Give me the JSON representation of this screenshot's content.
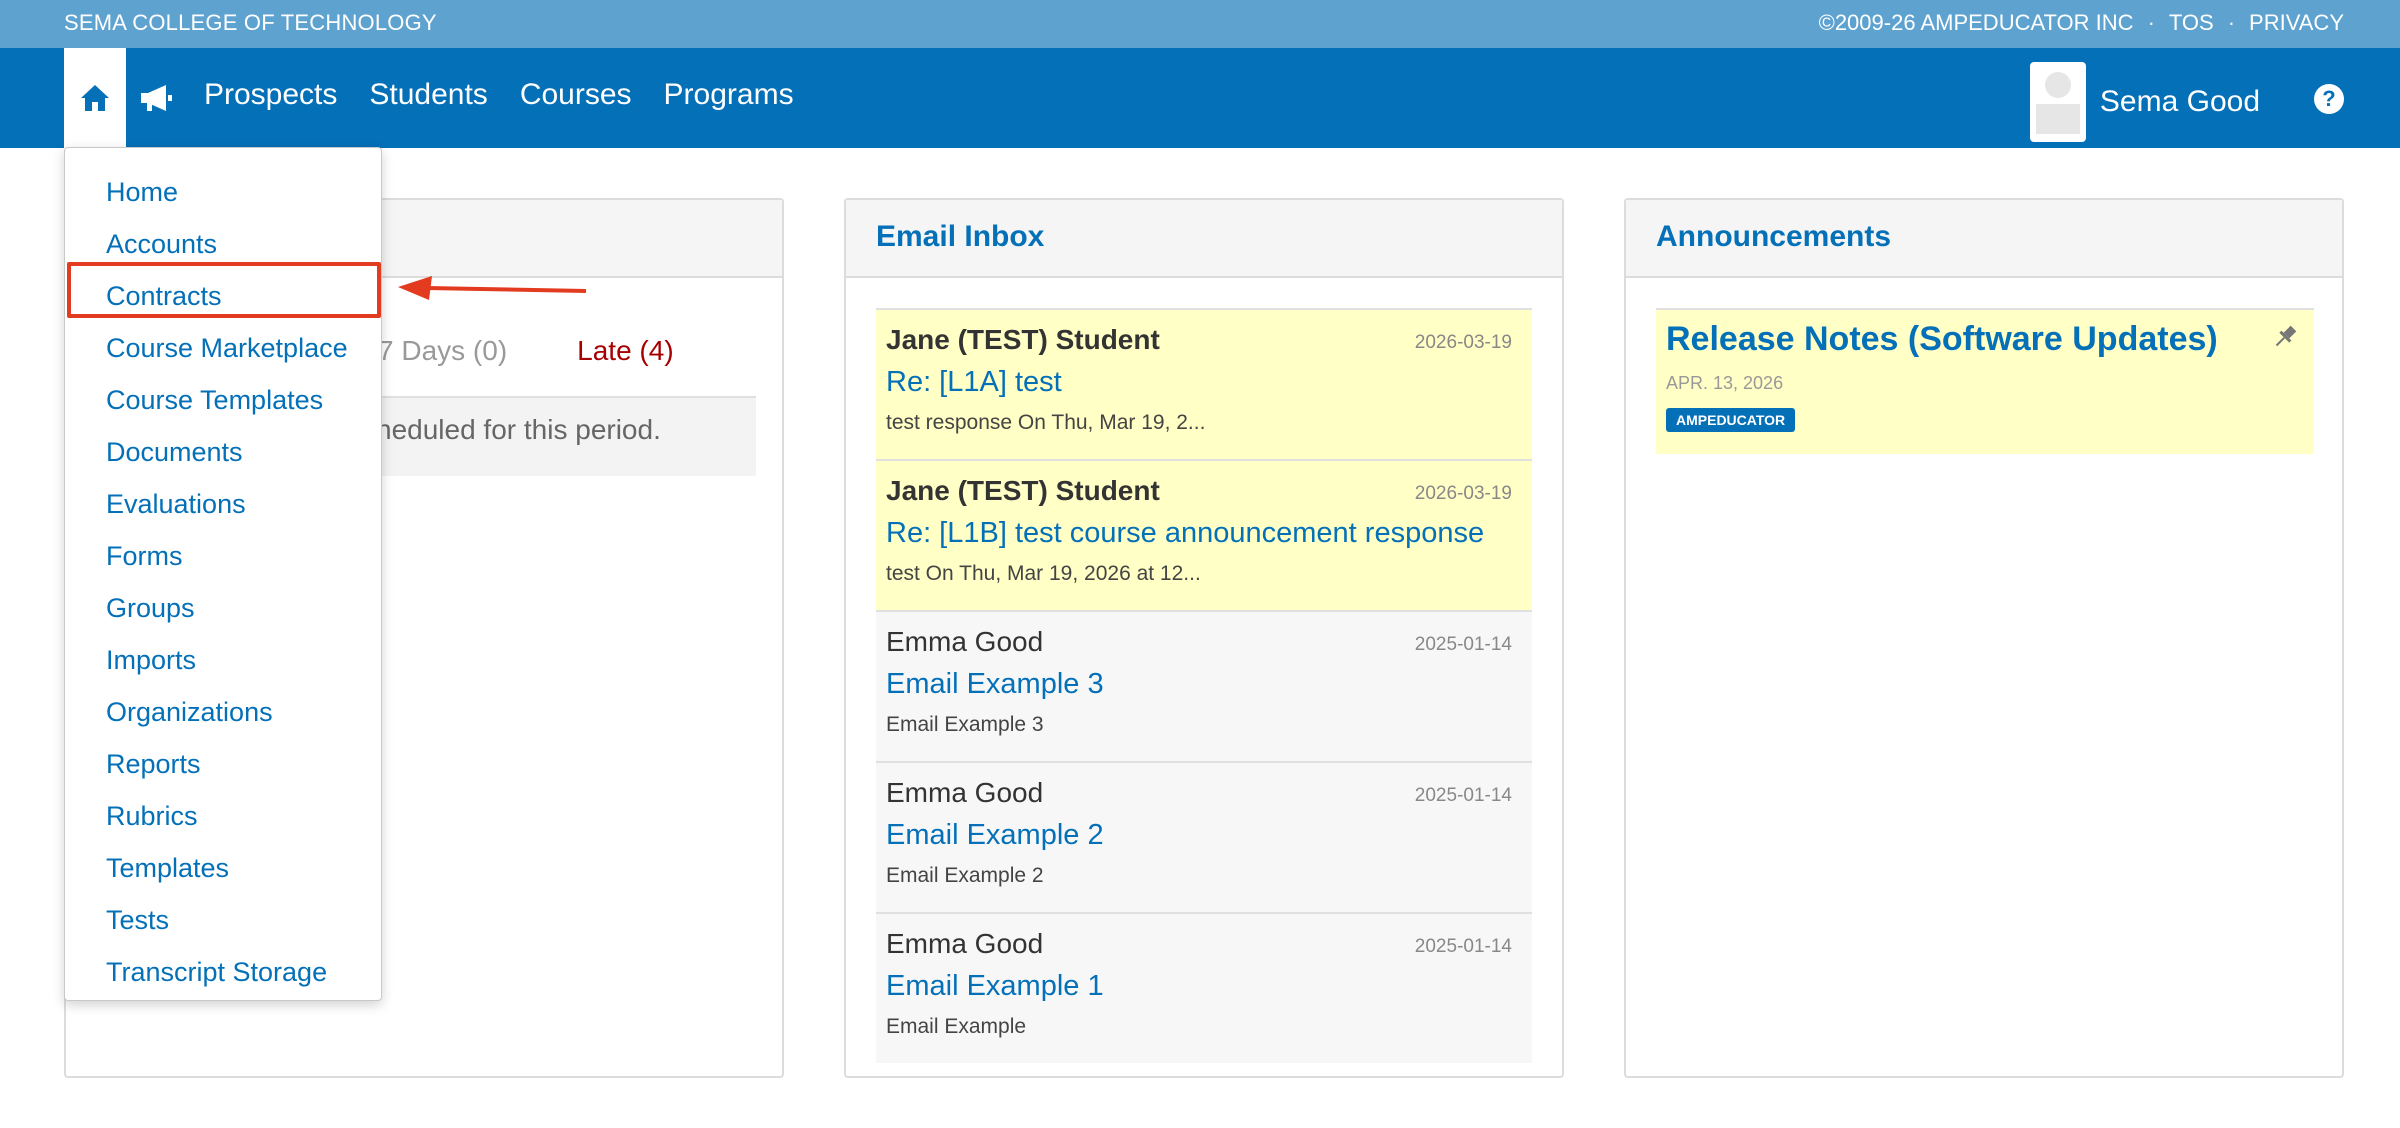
{
  "top_strip": {
    "school": "SEMA COLLEGE OF TECHNOLOGY",
    "copyright": "©2009-26 AMPEDUCATOR INC",
    "tos": "TOS",
    "privacy": "PRIVACY",
    "separator": "·"
  },
  "nav": {
    "links": [
      "Prospects",
      "Students",
      "Courses",
      "Programs"
    ],
    "user_name": "Sema Good",
    "help_glyph": "?",
    "icons": [
      "home-icon",
      "megaphone-icon",
      "avatar",
      "help-icon"
    ],
    "colors": {
      "primary": "#0470b8",
      "strip": "#5ea2d0"
    }
  },
  "dropdown": {
    "items": [
      "Home",
      "Accounts",
      "Contracts",
      "Course Marketplace",
      "Course Templates",
      "Documents",
      "Evaluations",
      "Forms",
      "Groups",
      "Imports",
      "Organizations",
      "Reports",
      "Rubrics",
      "Templates",
      "Tests",
      "Transcript Storage"
    ],
    "highlighted_item": "Contracts",
    "highlight_color": "#e33b1f"
  },
  "tasks_panel": {
    "tab_next7": "7 Days (0)",
    "tab_late": "Late (4)",
    "empty_text": "heduled for this period."
  },
  "email_panel": {
    "title": "Email Inbox",
    "emails": [
      {
        "from": "Jane (TEST) Student",
        "date": "2026-03-19",
        "subject": "Re: [L1A] test",
        "preview": "test response On Thu, Mar 19, 2...",
        "unread": true
      },
      {
        "from": "Jane (TEST) Student",
        "date": "2026-03-19",
        "subject": "Re: [L1B] test course announcement response",
        "preview": "test On Thu, Mar 19, 2026 at 12...",
        "unread": true
      },
      {
        "from": "Emma Good",
        "date": "2025-01-14",
        "subject": "Email Example 3",
        "preview": "Email Example 3",
        "unread": false
      },
      {
        "from": "Emma Good",
        "date": "2025-01-14",
        "subject": "Email Example 2",
        "preview": "Email Example 2",
        "unread": false
      },
      {
        "from": "Emma Good",
        "date": "2025-01-14",
        "subject": "Email Example 1",
        "preview": "Email Example",
        "unread": false
      }
    ]
  },
  "announcements_panel": {
    "title": "Announcements",
    "items": [
      {
        "title": "Release Notes (Software Updates)",
        "date": "APR. 13, 2026",
        "badge": "AMPEDUCATOR",
        "icon": "pin-icon"
      }
    ]
  }
}
